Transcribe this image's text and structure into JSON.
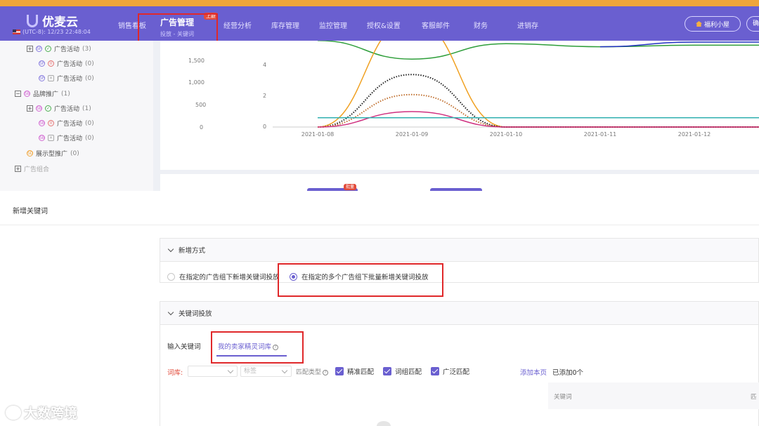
{
  "topbar": {
    "logo_text": "优麦云",
    "clock": "(UTC-8): 12/23 22:48:04",
    "nav": [
      {
        "label": "销售看板"
      },
      {
        "label": "经营分析"
      },
      {
        "label": "库存管理"
      },
      {
        "label": "监控管理"
      },
      {
        "label": "授权&设置"
      },
      {
        "label": "客服邮件"
      },
      {
        "label": "财务"
      },
      {
        "label": "进销存"
      }
    ],
    "active": {
      "label": "广告管理",
      "sub": "投放 - 关键词",
      "badge": "上新"
    },
    "welfare_label": "福利小屋",
    "extra_label": "确"
  },
  "tree": {
    "rows": [
      {
        "expander": "+",
        "icons": [
          "SP",
          "✓"
        ],
        "label": "广告活动",
        "count": "(3)"
      },
      {
        "expander": "",
        "icons": [
          "SP",
          "II"
        ],
        "label": "广告活动",
        "count": "(0)"
      },
      {
        "expander": "",
        "icons": [
          "SP",
          "✕"
        ],
        "label": "广告活动",
        "count": "(0)"
      },
      {
        "expander": "−",
        "icons": [
          "SB"
        ],
        "label": "品牌推广",
        "count": "(1)"
      },
      {
        "expander": "+",
        "icons": [
          "SB",
          "✓"
        ],
        "label": "广告活动",
        "count": "(1)"
      },
      {
        "expander": "",
        "icons": [
          "SB",
          "II"
        ],
        "label": "广告活动",
        "count": "(0)"
      },
      {
        "expander": "",
        "icons": [
          "SB",
          "✕"
        ],
        "label": "广告活动",
        "count": "(0)"
      },
      {
        "expander": "",
        "icons": [
          "SD"
        ],
        "label": "展示型推广",
        "count": "(0)"
      },
      {
        "expander": "+",
        "icons": [],
        "label": "广告组合",
        "count": ""
      }
    ]
  },
  "chart_data": {
    "type": "line",
    "x": [
      "2021-01-08",
      "2021-01-09",
      "2021-01-10",
      "2021-01-11",
      "2021-01-12"
    ],
    "left_axis_ticks": [
      "1,500",
      "1,000",
      "500",
      "0"
    ],
    "right_axis_ticks": [
      "4",
      "2",
      "0"
    ],
    "series": [
      {
        "color": "#2e9e3a",
        "style": "solid",
        "values": [
          5.6,
          4.4,
          5.4,
          5.2,
          5.3
        ]
      },
      {
        "color": "#f0a020",
        "style": "solid",
        "values": [
          0,
          7,
          0,
          0,
          0
        ]
      },
      {
        "color": "#222222",
        "style": "dotted",
        "values": [
          0,
          3.4,
          0,
          0,
          0
        ]
      },
      {
        "color": "#c07030",
        "style": "dotted",
        "values": [
          0,
          2.1,
          0,
          0,
          0
        ]
      },
      {
        "color": "#d03080",
        "style": "solid",
        "values": [
          0,
          1.0,
          0,
          0,
          0
        ]
      },
      {
        "color": "#30b0b0",
        "style": "solid",
        "values": [
          0.6,
          0.6,
          0.6,
          0.6,
          0.6
        ]
      },
      {
        "color": "#2030c0",
        "style": "solid",
        "values": [
          null,
          null,
          null,
          5.2,
          5.5
        ]
      }
    ]
  },
  "tab_strip_badge": "批量",
  "modal": {
    "title": "新增关键词",
    "section1": {
      "title": "新增方式",
      "options": [
        {
          "label": "在指定的广告组下新增关键词投放",
          "selected": false
        },
        {
          "label": "在指定的多个广告组下批量新增关键词投放",
          "selected": true
        }
      ]
    },
    "section2": {
      "title": "关键词投放",
      "tabs": [
        {
          "label": "输入关键词",
          "active": false
        },
        {
          "label": "我的卖家精灵词库",
          "active": true
        }
      ],
      "lexicon_label": "词库:",
      "lexicon_placeholder": "",
      "tag_placeholder": "标签",
      "match_type_label": "匹配类型",
      "checks": [
        {
          "label": "精准匹配",
          "checked": true
        },
        {
          "label": "词组匹配",
          "checked": true
        },
        {
          "label": "广泛匹配",
          "checked": true
        }
      ],
      "add_page_link": "添加本页",
      "added_count": "已添加0个",
      "columns": [
        "关键词",
        "匹"
      ]
    }
  },
  "watermark": "大数跨境",
  "accent": "#6a5fd0",
  "highlight": "#e0282a"
}
